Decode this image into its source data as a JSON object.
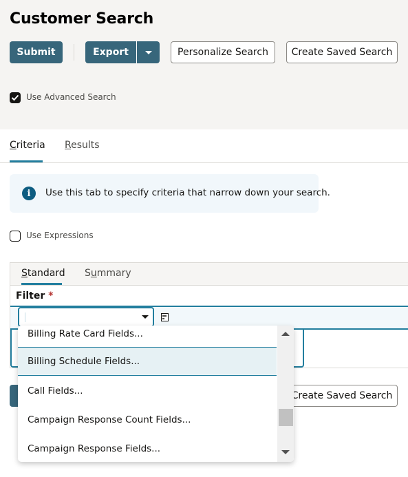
{
  "page": {
    "title": "Customer Search"
  },
  "toolbar": {
    "submit_label": "Submit",
    "export_label": "Export",
    "personalize_label": "Personalize Search",
    "create_saved_label": "Create Saved Search"
  },
  "options": {
    "use_advanced_search": {
      "label": "Use Advanced Search",
      "checked": true
    },
    "use_expressions": {
      "label": "Use Expressions",
      "checked": false
    }
  },
  "tabs": [
    {
      "label": "Criteria",
      "accesskey": "C",
      "rest": "riteria",
      "active": true
    },
    {
      "label": "Results",
      "accesskey": "R",
      "rest": "esults",
      "active": false
    }
  ],
  "info_message": "Use this tab to specify criteria that narrow down your search.",
  "subtabs": [
    {
      "label": "Standard",
      "accesskey": "S",
      "rest": "tandard",
      "active": true
    },
    {
      "label": "Summary",
      "pre": "S",
      "accesskey": "u",
      "rest": "mmary",
      "active": false
    }
  ],
  "filter": {
    "label": "Filter",
    "required_mark": "*",
    "value": "",
    "dropdown_options": [
      "Billing Rate Card Fields...",
      "Billing Schedule Fields...",
      "Call Fields...",
      "Campaign Response Count Fields...",
      "Campaign Response Fields..."
    ],
    "highlighted_option": "Billing Schedule Fields..."
  },
  "bottom_toolbar": {
    "create_saved_label": "Create Saved Search"
  },
  "colors": {
    "primary_button": "#37667b",
    "accent": "#227e9e",
    "info_icon": "#0e5d81",
    "required": "#b3312f"
  }
}
